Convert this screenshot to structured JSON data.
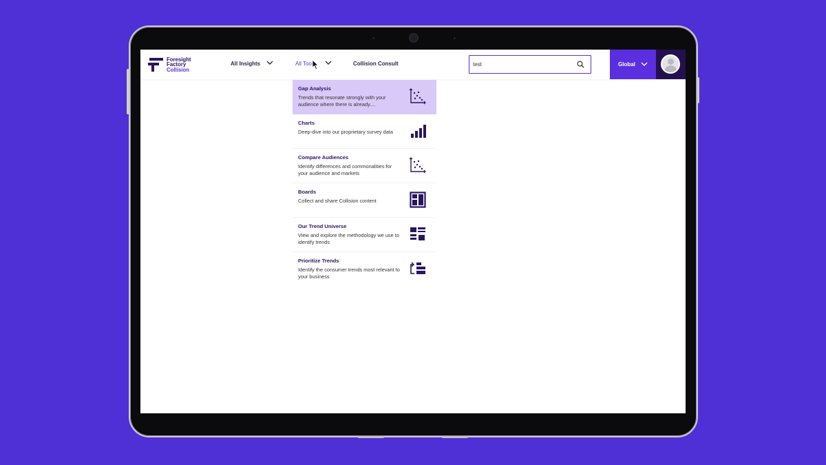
{
  "colors": {
    "background": "#4f2fd6",
    "brand_dark": "#2a1560",
    "accent": "#5b2ee0",
    "highlight": "#d9c9f8",
    "avatar_bg": "#25104f"
  },
  "logo": {
    "line1": "Foresight",
    "line2": "Factory",
    "line3": "Collision"
  },
  "nav": {
    "items": [
      {
        "label": "All Insights",
        "has_dropdown": true
      },
      {
        "label": "All Tools",
        "has_dropdown": true,
        "active": true
      },
      {
        "label": "Collision Consult",
        "has_dropdown": false
      }
    ]
  },
  "search": {
    "value": "test",
    "icon": "search-icon"
  },
  "region": {
    "label": "Global",
    "icon": "chevron-down-icon"
  },
  "user": {
    "icon": "avatar-icon"
  },
  "dropdown": {
    "items": [
      {
        "title": "Gap Analysis",
        "description": "Trends that resonate strongly with your audience where there is already....",
        "icon": "scatter-plot-icon",
        "highlighted": true
      },
      {
        "title": "Charts",
        "description": "Deep-dive into our proprietary survey data",
        "icon": "bar-chart-icon"
      },
      {
        "title": "Compare Audiences",
        "description": "Identify differences and commonalities for your audience and markets",
        "icon": "scatter-plot-icon"
      },
      {
        "title": "Boards",
        "description": "Collect and share Collision content",
        "icon": "board-layout-icon"
      },
      {
        "title": "Our Trend Universe",
        "description": "View and explore the methodology we use to identify trends",
        "icon": "list-grid-icon"
      },
      {
        "title": "Prioritize Trends",
        "description": "Identify the consumer trends most relevant to your business",
        "icon": "prioritize-icon"
      }
    ]
  }
}
